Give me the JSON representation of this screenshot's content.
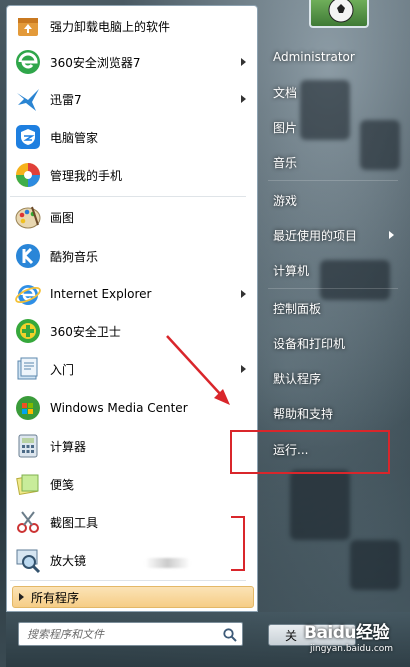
{
  "left_programs": [
    {
      "label": "强力卸载电脑上的软件",
      "icon": "uninstall-box-icon",
      "has_arrow": false
    },
    {
      "label": "360安全浏览器7",
      "icon": "360-browser-icon",
      "has_arrow": true
    },
    {
      "label": "迅雷7",
      "icon": "thunder-bird-icon",
      "has_arrow": true
    },
    {
      "label": "电脑管家",
      "icon": "pc-manager-shield-icon",
      "has_arrow": false
    },
    {
      "label": "管理我的手机",
      "icon": "phone-manager-icon",
      "has_arrow": false
    },
    {
      "label": "画图",
      "icon": "paint-palette-icon",
      "has_arrow": false
    },
    {
      "label": "酷狗音乐",
      "icon": "kugou-k-icon",
      "has_arrow": false
    },
    {
      "label": "Internet Explorer",
      "icon": "internet-explorer-icon",
      "has_arrow": true
    },
    {
      "label": "360安全卫士",
      "icon": "360-guard-icon",
      "has_arrow": false
    },
    {
      "label": "入门",
      "icon": "getting-started-icon",
      "has_arrow": true
    },
    {
      "label": "Windows Media Center",
      "icon": "media-center-icon",
      "has_arrow": false
    },
    {
      "label": "计算器",
      "icon": "calculator-icon",
      "has_arrow": false
    },
    {
      "label": "便笺",
      "icon": "sticky-notes-icon",
      "has_arrow": false
    },
    {
      "label": "截图工具",
      "icon": "snipping-tool-icon",
      "has_arrow": false
    },
    {
      "label": "放大镜",
      "icon": "magnifier-icon",
      "has_arrow": false
    }
  ],
  "all_programs_label": "所有程序",
  "search": {
    "placeholder": "搜索程序和文件"
  },
  "shutdown_label": "关",
  "right_items": [
    {
      "label": "Administrator",
      "has_arrow": false
    },
    {
      "label": "文档",
      "has_arrow": false
    },
    {
      "label": "图片",
      "has_arrow": false
    },
    {
      "label": "音乐",
      "has_arrow": false
    },
    {
      "label": "游戏",
      "has_arrow": false
    },
    {
      "label": "最近使用的项目",
      "has_arrow": true
    },
    {
      "label": "计算机",
      "has_arrow": false
    },
    {
      "label": "控制面板",
      "has_arrow": false
    },
    {
      "label": "设备和打印机",
      "has_arrow": false
    },
    {
      "label": "默认程序",
      "has_arrow": false
    },
    {
      "label": "帮助和支持",
      "has_arrow": false
    },
    {
      "label": "运行...",
      "has_arrow": false
    }
  ],
  "watermark": {
    "main": "Baidu经验",
    "sub": "jingyan.baidu.com"
  },
  "colors": {
    "annotation": "#d9262b",
    "all_programs_bg": "#f6cd86"
  }
}
